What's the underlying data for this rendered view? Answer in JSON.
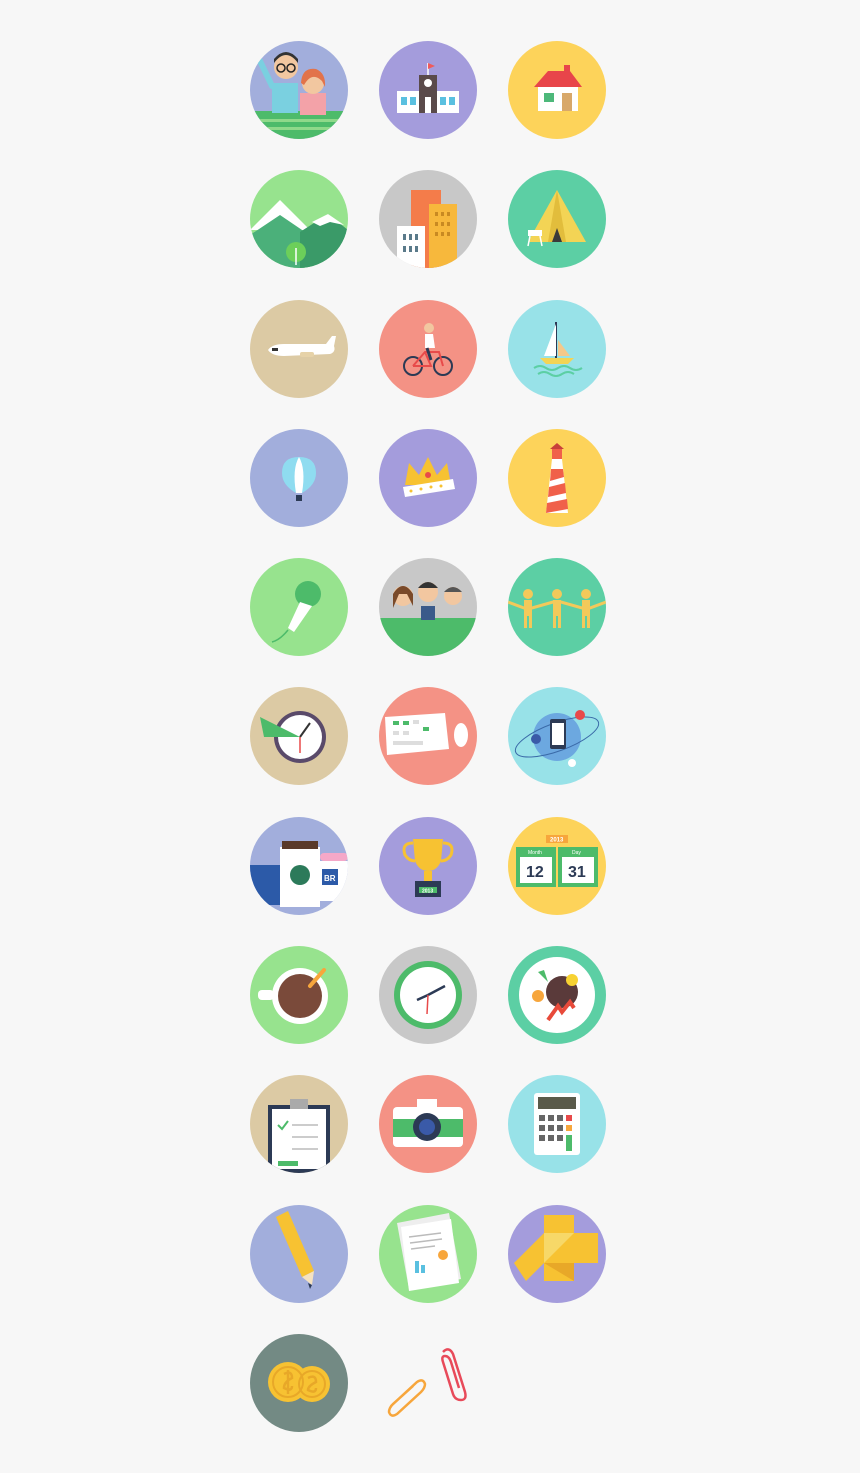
{
  "icons": [
    {
      "name": "couple-icon",
      "color": "#a2aedc"
    },
    {
      "name": "school-icon",
      "color": "#a49cdc"
    },
    {
      "name": "house-icon",
      "color": "#fdd35a"
    },
    {
      "name": "mountains-icon",
      "color": "#97e38e"
    },
    {
      "name": "city-buildings-icon",
      "color": "#c8c8c8"
    },
    {
      "name": "camping-tent-icon",
      "color": "#5ccfa4"
    },
    {
      "name": "airplane-icon",
      "color": "#dccaa4"
    },
    {
      "name": "cyclist-icon",
      "color": "#f49285"
    },
    {
      "name": "sailboat-icon",
      "color": "#98e2e8"
    },
    {
      "name": "hot-air-balloon-icon",
      "color": "#a2aedc"
    },
    {
      "name": "crown-icon",
      "color": "#a49cdc"
    },
    {
      "name": "lighthouse-icon",
      "color": "#fdd35a"
    },
    {
      "name": "microphone-icon",
      "color": "#97e38e"
    },
    {
      "name": "group-people-icon",
      "color": "#c8c8c8"
    },
    {
      "name": "people-chain-icon",
      "color": "#5ccfa4"
    },
    {
      "name": "clock-radar-icon",
      "color": "#dccaa4"
    },
    {
      "name": "keyboard-mouse-icon",
      "color": "#f49285"
    },
    {
      "name": "globe-phone-icon",
      "color": "#98e2e8"
    },
    {
      "name": "coffee-cups-icon",
      "color": "#a2aedc"
    },
    {
      "name": "trophy-icon",
      "color": "#a49cdc"
    },
    {
      "name": "calendar-icon",
      "color": "#fdd35a"
    },
    {
      "name": "coffee-mug-icon",
      "color": "#97e38e"
    },
    {
      "name": "wall-clock-icon",
      "color": "#c8c8c8"
    },
    {
      "name": "food-plate-icon",
      "color": "#5ccfa4"
    },
    {
      "name": "clipboard-icon",
      "color": "#dccaa4"
    },
    {
      "name": "camera-icon",
      "color": "#f49285"
    },
    {
      "name": "calculator-icon",
      "color": "#98e2e8"
    },
    {
      "name": "pencil-icon",
      "color": "#a2aedc"
    },
    {
      "name": "documents-icon",
      "color": "#97e38e"
    },
    {
      "name": "origami-icon",
      "color": "#a49cdc"
    },
    {
      "name": "coins-icon",
      "color": "#738a84"
    },
    {
      "name": "paperclips-icon",
      "color": "transparent"
    }
  ],
  "calendar": {
    "year": "2013",
    "month_label": "Month",
    "day_label": "Day",
    "month": "12",
    "day": "31"
  },
  "trophy": {
    "year": "2013"
  },
  "coffee_brand": {
    "label": "BR"
  }
}
